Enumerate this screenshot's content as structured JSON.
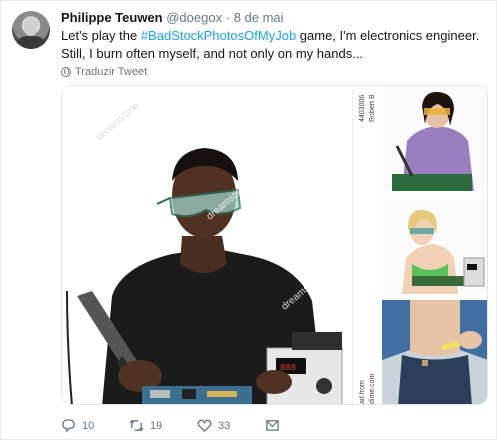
{
  "author": {
    "name": "Philippe Teuwen",
    "handle": "@doegox",
    "separator": "·",
    "date": "8 de mai"
  },
  "tweet": {
    "text_before": "Let's play the ",
    "hashtag": "#BadStockPhotosOfMyJob",
    "text_after": " game, I'm electronics engineer. Still, I burn often myself, and not only on my hands..."
  },
  "translate_label": "Traduzir Tweet",
  "media": {
    "strip_texts": [
      "4403006",
      "Robert B",
      "ad from",
      "dime.com"
    ]
  },
  "actions": {
    "reply_count": "10",
    "retweet_count": "19",
    "like_count": "33"
  },
  "icons": [
    "avatar",
    "globe-icon",
    "reply-icon",
    "retweet-icon",
    "like-icon",
    "message-icon"
  ]
}
